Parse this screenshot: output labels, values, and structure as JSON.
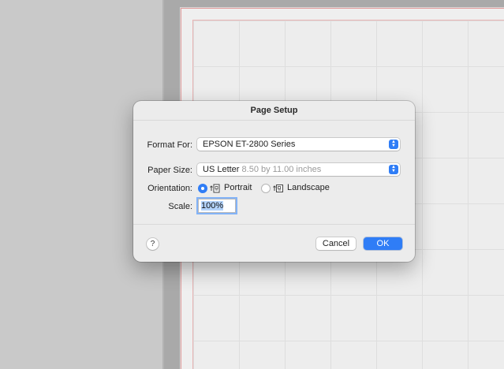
{
  "dialog": {
    "title": "Page Setup",
    "format_for": {
      "label": "Format For:",
      "value": "EPSON ET-2800 Series"
    },
    "paper_size": {
      "label": "Paper Size:",
      "value": "US Letter",
      "detail": "8.50 by 11.00 inches"
    },
    "orientation": {
      "label": "Orientation:",
      "options": [
        {
          "label": "Portrait",
          "selected": true,
          "icon": "portrait-orientation-icon"
        },
        {
          "label": "Landscape",
          "selected": false,
          "icon": "landscape-orientation-icon"
        }
      ]
    },
    "scale": {
      "label": "Scale:",
      "value": "100%"
    },
    "help_label": "?",
    "cancel_label": "Cancel",
    "ok_label": "OK"
  },
  "colors": {
    "accent": "#2f7df6",
    "dialog_bg": "#ececec",
    "canvas_bg": "#a9a9a9"
  }
}
